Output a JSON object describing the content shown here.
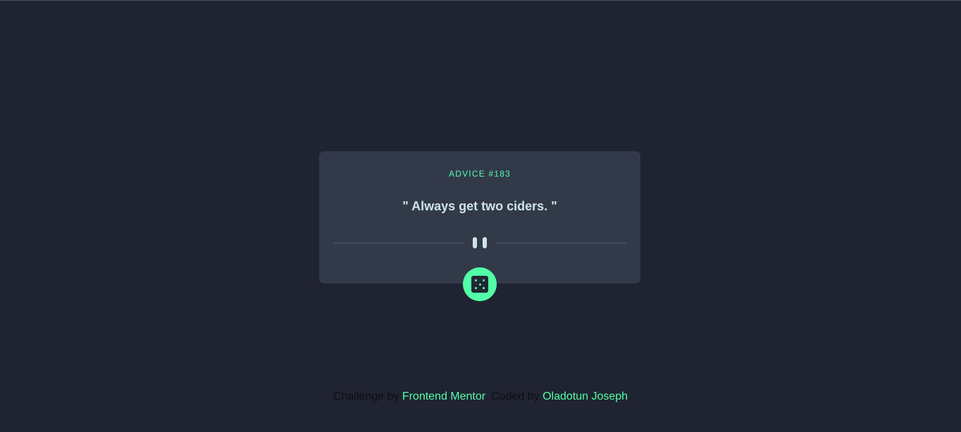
{
  "card": {
    "advice_id": "ADVICE #183",
    "advice_text": "\" Always get two ciders. \""
  },
  "icons": {
    "divider": "pause-icon",
    "button": "dice-icon"
  },
  "footer": {
    "challenge_prefix": "Challenge by",
    "challenge_link": "Frontend Mentor",
    "coded_prefix": ". Coded by",
    "coded_link": "Oladotun Joseph"
  },
  "colors": {
    "background": "#202331",
    "card": "#323a4a",
    "accent": "#52ffa8",
    "text": "#cee3e9"
  }
}
